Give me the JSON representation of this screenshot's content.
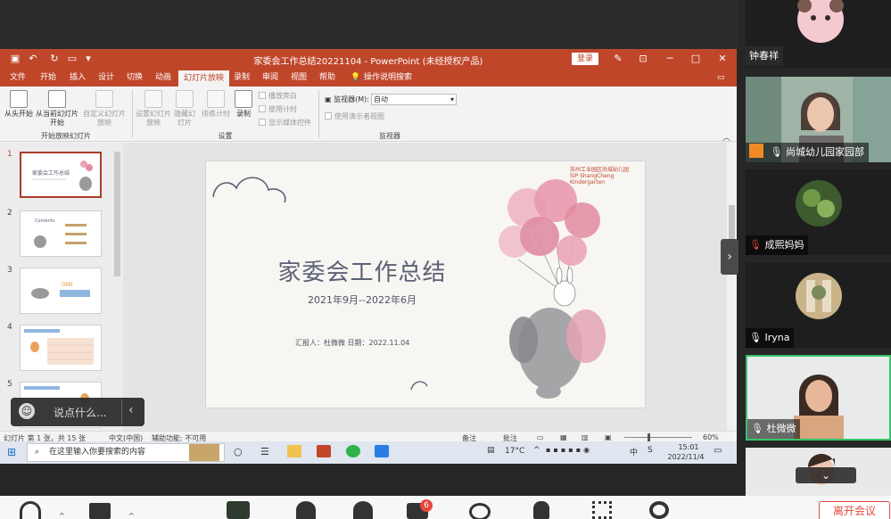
{
  "powerpoint": {
    "window_title": "家委会工作总结20221104 - PowerPoint (未经授权产品)",
    "login_label": "登录",
    "menu": [
      "文件",
      "开始",
      "插入",
      "设计",
      "切换",
      "动画",
      "幻灯片放映",
      "录制",
      "审阅",
      "视图",
      "帮助"
    ],
    "active_menu": "幻灯片放映",
    "tell_me": "操作说明搜索",
    "ribbon": {
      "from_start": "从头开始",
      "from_current": "从当前幻灯片开始",
      "custom_show": "自定义幻灯片放映",
      "group_start": "开始放映幻灯片",
      "setup_show": "设置幻灯片放映",
      "hide_slide": "隐藏幻灯片",
      "rehearse": "排练计时",
      "record": "录制",
      "group_setup": "设置",
      "chk_narration": "播放旁白",
      "chk_timing": "使用计时",
      "chk_controls": "显示媒体控件",
      "monitor_label": "监视器(M):",
      "monitor_value": "自动",
      "chk_presenter": "使用演示者视图",
      "group_monitor": "监视器"
    },
    "thumbnails": [
      "1",
      "2",
      "3",
      "4",
      "5"
    ],
    "slide": {
      "title": "家委会工作总结",
      "date_range": "2021年9月--2022年6月",
      "reporter": "汇报人：杜微微   日期：2022.11.04",
      "logo_line1": "苏州工业园区尚城幼儿园",
      "logo_line2": "SIP ShangCheng Kindergarten"
    },
    "status": {
      "slide_info": "幻灯片 第 1 张，共 15 张",
      "language": "中文(中国)",
      "accessibility": "辅助功能: 不可用",
      "notes": "备注",
      "comments": "批注",
      "zoom": "60%"
    }
  },
  "taskbar": {
    "search_placeholder": "在这里输入你要搜索的内容",
    "temperature": "17°C",
    "time": "15:01",
    "date": "2022/11/4"
  },
  "chat": {
    "placeholder": "说点什么..."
  },
  "participants": [
    {
      "name": "钟春祥"
    },
    {
      "name": "尚城幼儿园家园部"
    },
    {
      "name": "成熙妈妈"
    },
    {
      "name": "Iryna"
    },
    {
      "name": "杜微微"
    }
  ],
  "toolbar": {
    "chat_badge": "6",
    "leave_label": "离开会议"
  },
  "colors": {
    "ppt_accent": "#c0462a",
    "active_speaker_border": "#38c46b",
    "leave_red": "#e04a3f"
  }
}
